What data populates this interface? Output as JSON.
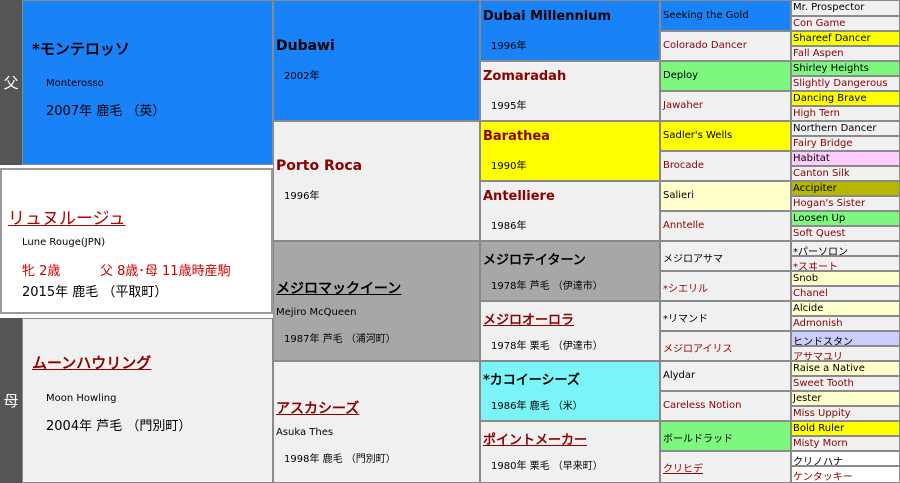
{
  "labels": {
    "sire_side": "父",
    "dam_side": "母"
  },
  "subject": {
    "name": "リュヌルージュ",
    "name_en": "Lune Rouge(JPN)",
    "sex_age": "牝 2歳",
    "parents_age": "父 8歳･母 11歳時産駒",
    "birth": "2015年  鹿毛 （平取町）"
  },
  "sire": {
    "name": "*モンテロッソ",
    "name_en": "Monterosso",
    "info": "2007年  鹿毛 （英）"
  },
  "dam": {
    "name": "ムーンハウリング",
    "name_en": "Moon Howling",
    "info": "2004年  芦毛 （門別町）"
  },
  "g2": [
    {
      "name": "Dubawi",
      "name_en": "",
      "info": "2002年"
    },
    {
      "name": "Porto Roca",
      "name_en": "",
      "info": "1996年"
    },
    {
      "name": "メジロマックイーン",
      "name_en": "Mejiro McQueen",
      "info": "1987年  芦毛 （浦河町）"
    },
    {
      "name": "アスカシーズ",
      "name_en": "Asuka Thes",
      "info": "1998年  鹿毛 （門別町）"
    }
  ],
  "g3": [
    {
      "name": "Dubai Millennium",
      "info": "1996年"
    },
    {
      "name": "Zomaradah",
      "info": "1995年"
    },
    {
      "name": "Barathea",
      "info": "1990年"
    },
    {
      "name": "Antelliere",
      "info": "1986年"
    },
    {
      "name": "メジロテイターン",
      "info": "1978年  芦毛 （伊達市）"
    },
    {
      "name": "メジロオーロラ",
      "info": "1978年  栗毛 （伊達市）"
    },
    {
      "name": "*カコイーシーズ",
      "info": "1986年  鹿毛 （米）"
    },
    {
      "name": "ポイントメーカー",
      "info": "1980年  栗毛 （早来町）"
    }
  ],
  "g4": [
    "Seeking the Gold",
    "Colorado Dancer",
    "Deploy",
    "Jawaher",
    "Sadler's Wells",
    "Brocade",
    "Salieri",
    "Anntelle",
    "メジロアサマ",
    "*シエリル",
    "*リマンド",
    "メジロアイリス",
    "Alydar",
    "Careless Notion",
    "ボールドラッド",
    "クリヒデ"
  ],
  "g5": [
    "Mr. Prospector",
    "Con Game",
    "Shareef Dancer",
    "Fall Aspen",
    "Shirley Heights",
    "Slightly Dangerous",
    "Dancing Brave",
    "High Tern",
    "Northern Dancer",
    "Fairy Bridge",
    "Habitat",
    "Canton Silk",
    "Accipiter",
    "Hogan's Sister",
    "Loosen Up",
    "Soft Quest",
    "*パーソロン",
    "*スヰート",
    "Snob",
    "Chanel",
    "Alcide",
    "Admonish",
    "ヒンドスタン",
    "アサマユリ",
    "Raise a Native",
    "Sweet Tooth",
    "Jester",
    "Miss Uppity",
    "Bold Ruler",
    "Misty Morn",
    "クリノハナ",
    "ケンタッキー"
  ]
}
